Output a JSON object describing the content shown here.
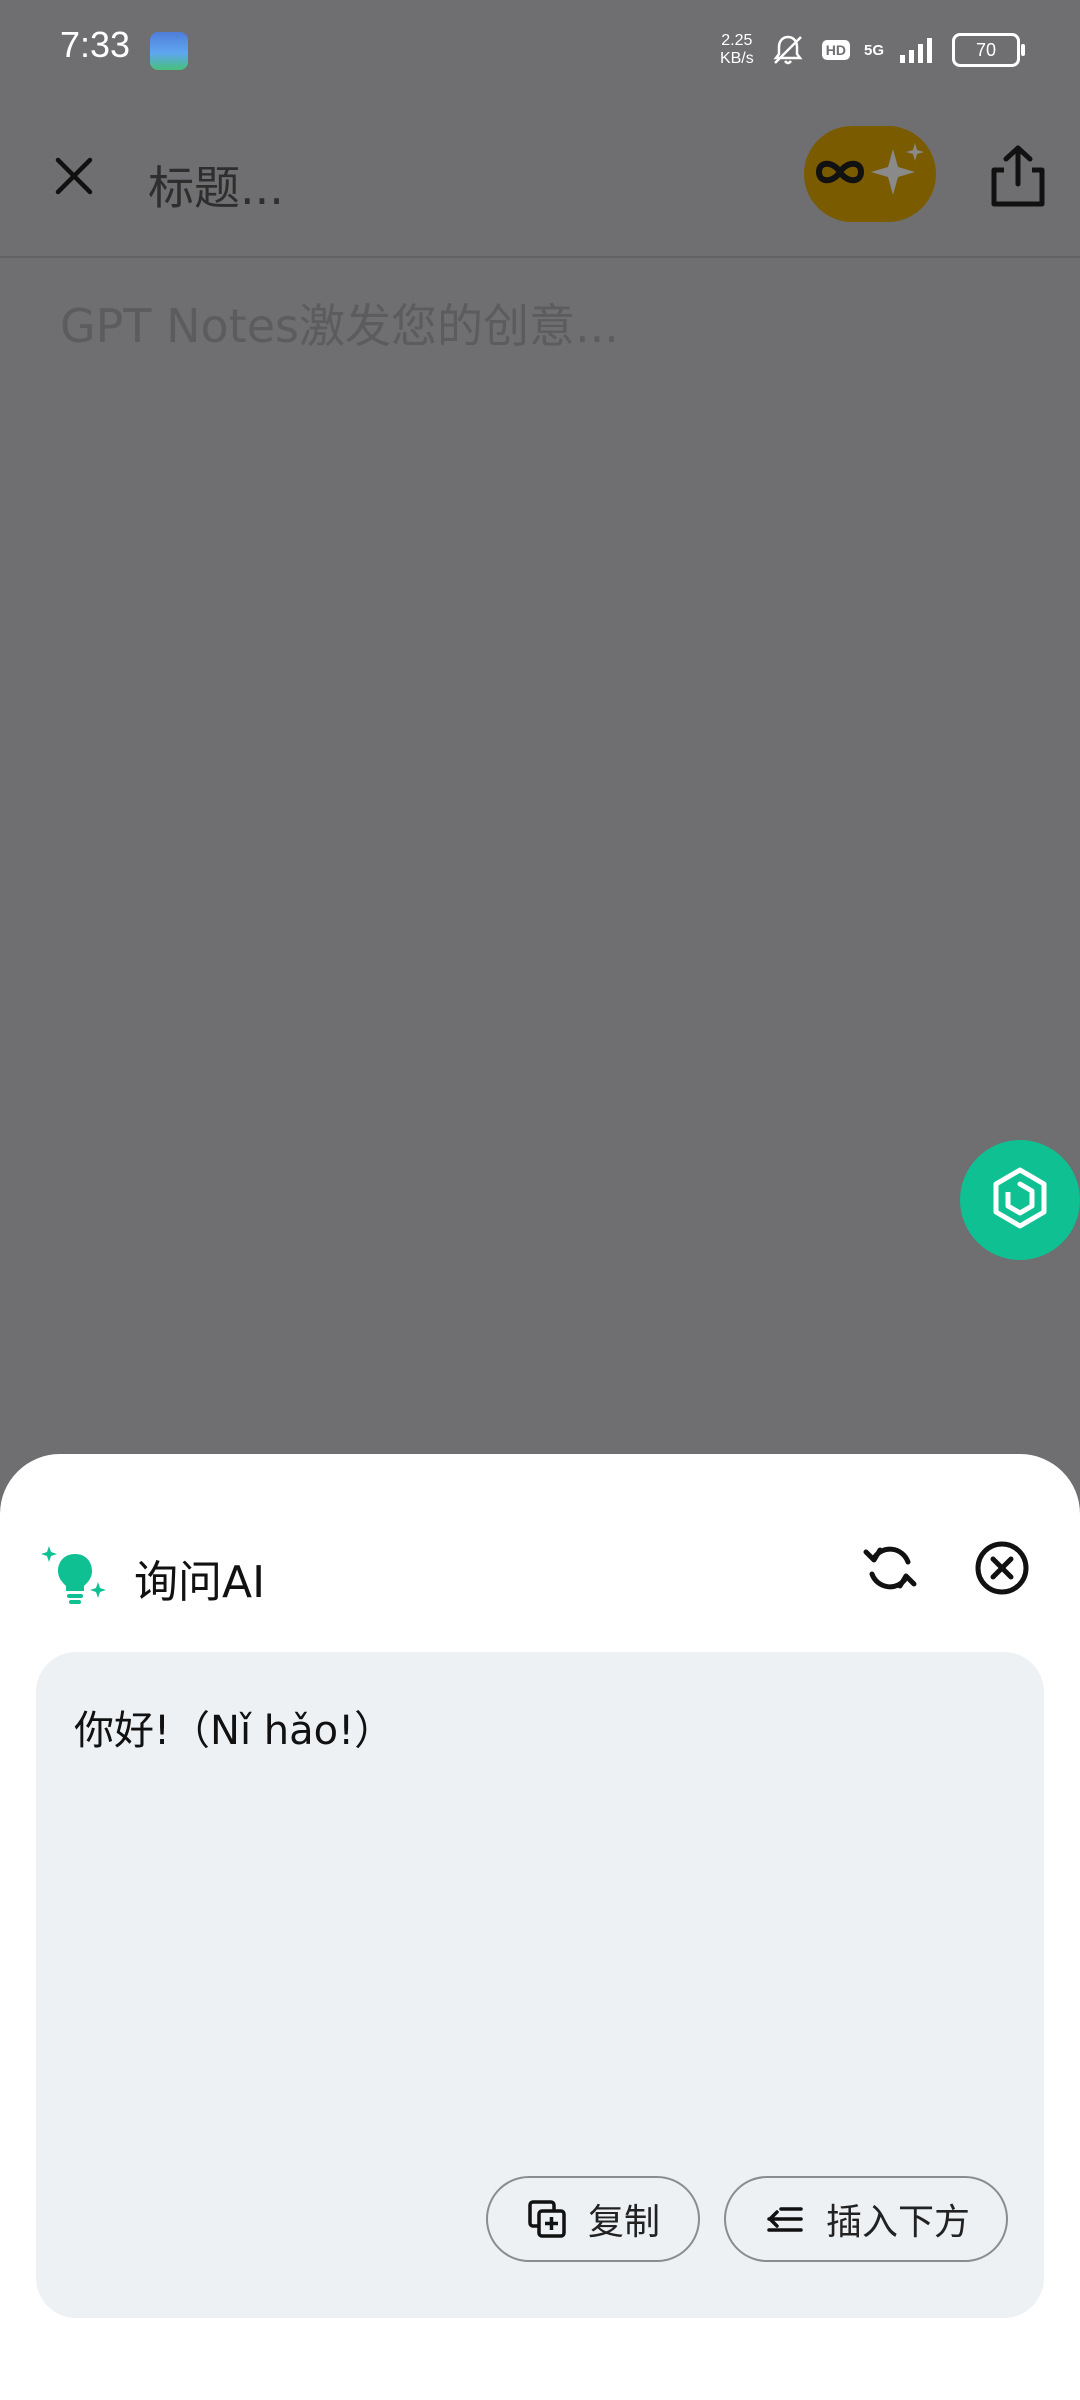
{
  "status_bar": {
    "time": "7:33",
    "net_speed_value": "2.25",
    "net_speed_unit": "KB/s",
    "hd_label": "HD",
    "network_label": "5G",
    "battery_level": "70"
  },
  "editor": {
    "title_placeholder": "标题...",
    "body_placeholder": "GPT Notes激发您的创意..."
  },
  "ask_ai_sheet": {
    "title": "询问AI",
    "answer": "你好!（Nǐ hǎo!）",
    "copy_label": "复制",
    "insert_label": "插入下方"
  },
  "colors": {
    "accent": "#0fc092",
    "overlay_background": "#6f6f71",
    "card_background": "#eef1f4",
    "ai_pill": "#7a5b00"
  },
  "icons": [
    "close-icon",
    "infinity-sparkle-icon",
    "share-icon",
    "ai-fab-icon",
    "lightbulb-icon",
    "refresh-icon",
    "close-circle-icon",
    "copy-icon",
    "insert-below-icon"
  ]
}
